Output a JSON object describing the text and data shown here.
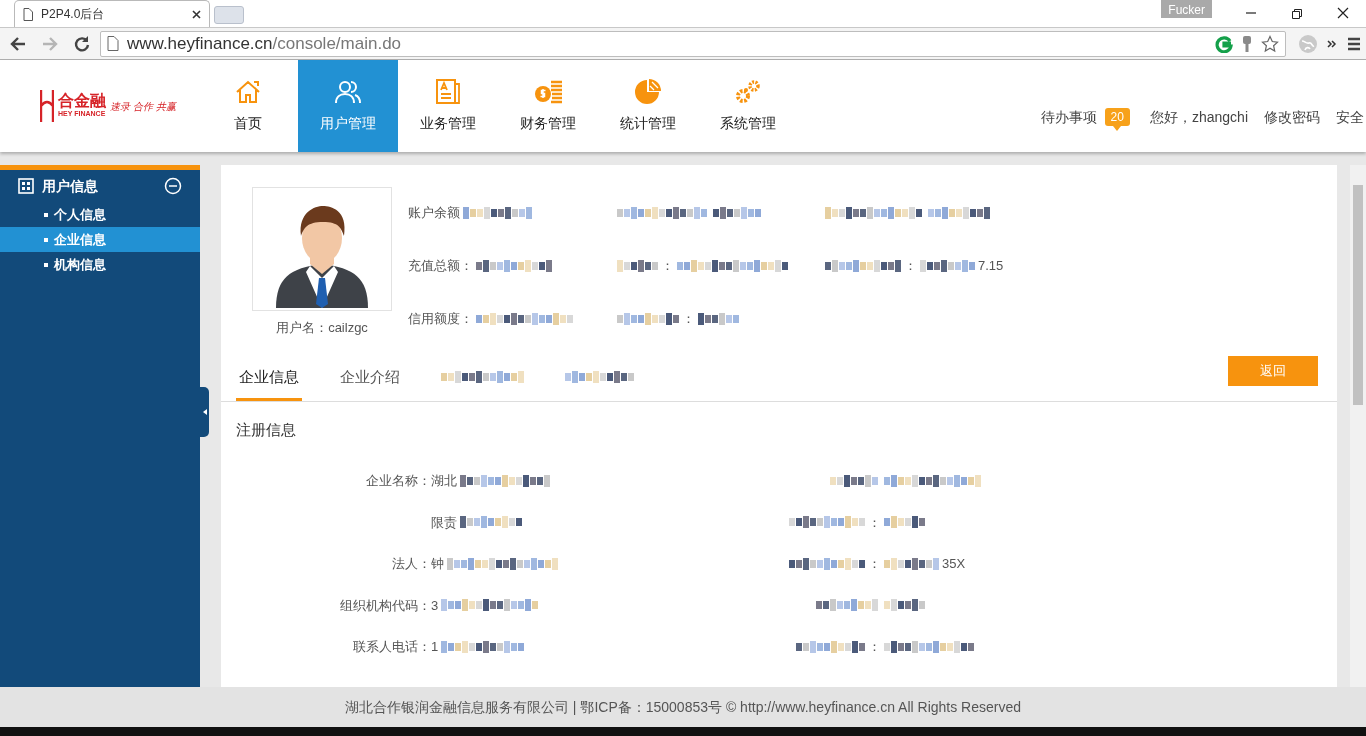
{
  "browser": {
    "tab_title": "P2P4.0后台",
    "profile_name": "Fucker",
    "url_host": "www.heyfinance.cn",
    "url_path": "/console/main.do"
  },
  "header": {
    "logo_name": "合金融",
    "logo_sub": "HEY FINANCE",
    "logo_slogan": "速录 合作 共赢",
    "nav": [
      {
        "label": "首页",
        "selected": false
      },
      {
        "label": "用户管理",
        "selected": true
      },
      {
        "label": "业务管理",
        "selected": false
      },
      {
        "label": "财务管理",
        "selected": false
      },
      {
        "label": "统计管理",
        "selected": false
      },
      {
        "label": "系统管理",
        "selected": false
      }
    ],
    "todo_label": "待办事项",
    "todo_count": "20",
    "greeting": "您好，zhangchi",
    "change_password": "修改密码",
    "logout": "安全"
  },
  "sidebar": {
    "title": "用户信息",
    "expanded": true,
    "items": [
      {
        "label": "个人信息",
        "selected": false
      },
      {
        "label": "企业信息",
        "selected": true
      },
      {
        "label": "机构信息",
        "selected": false
      }
    ]
  },
  "profile": {
    "username": "用户名：cailzgc",
    "stats": [
      [
        {
          "kind": "text",
          "text": "账户余额"
        },
        {
          "kind": "redacted"
        }
      ],
      [
        {
          "kind": "redacted"
        },
        {
          "kind": "redacted"
        }
      ],
      [
        {
          "kind": "redacted"
        },
        {
          "kind": "redacted"
        }
      ],
      [
        {
          "kind": "text",
          "text": "充值总额："
        },
        {
          "kind": "redacted"
        }
      ],
      [
        {
          "kind": "redacted"
        },
        {
          "kind": "text",
          "text": "："
        },
        {
          "kind": "redacted"
        }
      ],
      [
        {
          "kind": "redacted"
        },
        {
          "kind": "text",
          "text": "："
        },
        {
          "kind": "redacted"
        },
        {
          "kind": "text",
          "text": "7.15"
        }
      ],
      [
        {
          "kind": "text",
          "text": "信用额度："
        },
        {
          "kind": "redacted"
        }
      ],
      [
        {
          "kind": "redacted"
        },
        {
          "kind": "text",
          "text": "："
        },
        {
          "kind": "redacted"
        }
      ]
    ]
  },
  "tabs": [
    {
      "parts": [
        {
          "kind": "text",
          "text": "企业信息"
        }
      ],
      "selected": true
    },
    {
      "parts": [
        {
          "kind": "text",
          "text": "企业介绍"
        }
      ],
      "selected": false
    },
    {
      "parts": [
        {
          "kind": "redacted"
        }
      ],
      "selected": false
    },
    {
      "parts": [
        {
          "kind": "redacted"
        }
      ],
      "selected": false
    }
  ],
  "back_button": "返回",
  "section_title": "注册信息",
  "form_rows": [
    {
      "left_label": [
        {
          "kind": "text",
          "text": "企业名称："
        }
      ],
      "left_value": [
        {
          "kind": "text",
          "text": "湖北"
        },
        {
          "kind": "redacted"
        }
      ],
      "right_label": [
        {
          "kind": "redacted"
        }
      ],
      "right_value": [
        {
          "kind": "redacted"
        }
      ]
    },
    {
      "left_value": [
        {
          "kind": "text",
          "text": "限责"
        },
        {
          "kind": "redacted"
        }
      ],
      "right_label": [
        {
          "kind": "redacted"
        },
        {
          "kind": "text",
          "text": "："
        }
      ],
      "right_value": [
        {
          "kind": "redacted"
        }
      ]
    },
    {
      "left_label": [
        {
          "kind": "text",
          "text": "法人："
        }
      ],
      "left_value": [
        {
          "kind": "text",
          "text": "钟"
        },
        {
          "kind": "redacted"
        }
      ],
      "right_label": [
        {
          "kind": "redacted"
        },
        {
          "kind": "text",
          "text": "："
        }
      ],
      "right_value": [
        {
          "kind": "redacted"
        },
        {
          "kind": "text",
          "text": "35X"
        }
      ]
    },
    {
      "left_label": [
        {
          "kind": "text",
          "text": "组织机构代码："
        }
      ],
      "left_value": [
        {
          "kind": "text",
          "text": "3"
        },
        {
          "kind": "redacted"
        }
      ],
      "right_label": [
        {
          "kind": "redacted"
        }
      ],
      "right_value": [
        {
          "kind": "redacted"
        }
      ]
    },
    {
      "left_label": [
        {
          "kind": "text",
          "text": "联系人电话："
        }
      ],
      "left_value": [
        {
          "kind": "text",
          "text": "1"
        },
        {
          "kind": "redacted"
        }
      ],
      "right_label": [
        {
          "kind": "redacted"
        },
        {
          "kind": "text",
          "text": "："
        }
      ],
      "right_value": [
        {
          "kind": "redacted"
        }
      ]
    }
  ],
  "footer": "湖北合作银润金融信息服务有限公司 | 鄂ICP备：15000853号 © http://www.heyfinance.cn All Rights Reserved"
}
